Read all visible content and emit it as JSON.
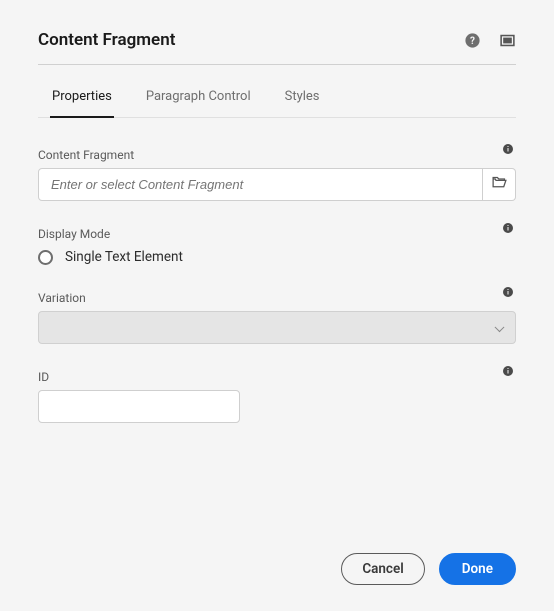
{
  "header": {
    "title": "Content Fragment"
  },
  "tabs": [
    {
      "label": "Properties",
      "active": true
    },
    {
      "label": "Paragraph Control",
      "active": false
    },
    {
      "label": "Styles",
      "active": false
    }
  ],
  "fields": {
    "contentFragment": {
      "label": "Content Fragment",
      "placeholder": "Enter or select Content Fragment",
      "value": ""
    },
    "displayMode": {
      "label": "Display Mode",
      "options": [
        {
          "label": "Single Text Element",
          "selected": false
        }
      ]
    },
    "variation": {
      "label": "Variation",
      "value": ""
    },
    "id": {
      "label": "ID",
      "value": ""
    }
  },
  "footer": {
    "cancel": "Cancel",
    "done": "Done"
  }
}
